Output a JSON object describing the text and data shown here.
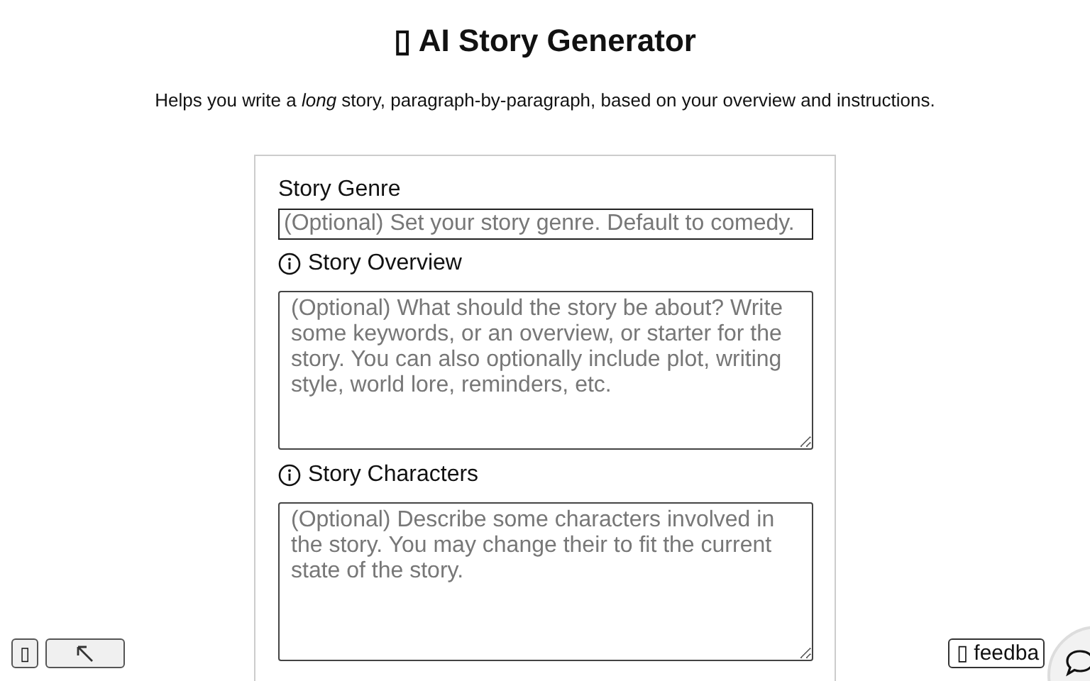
{
  "title": "▯ AI Story Generator",
  "subtitle": "Helps you write a *long* story, paragraph-by-paragraph, based on your overview and instructions.",
  "fields": [
    {
      "kind": "input",
      "label": "Story Genre",
      "info": false,
      "placeholder": "(Optional) Set your story genre. Default to comedy."
    },
    {
      "kind": "textarea",
      "label": "Story Overview",
      "info": true,
      "placeholder": "(Optional) What should the story be about? Write some keywords, or an overview, or starter for the story. You can also optionally include plot, writing style, world lore, reminders, etc."
    },
    {
      "kind": "textarea",
      "label": "Story Characters",
      "info": true,
      "placeholder": "(Optional) Describe some characters involved in the story. You may change their to fit the current state of the story."
    }
  ],
  "bottom_left_button": "▯",
  "feedback_button": "▯ feedba"
}
